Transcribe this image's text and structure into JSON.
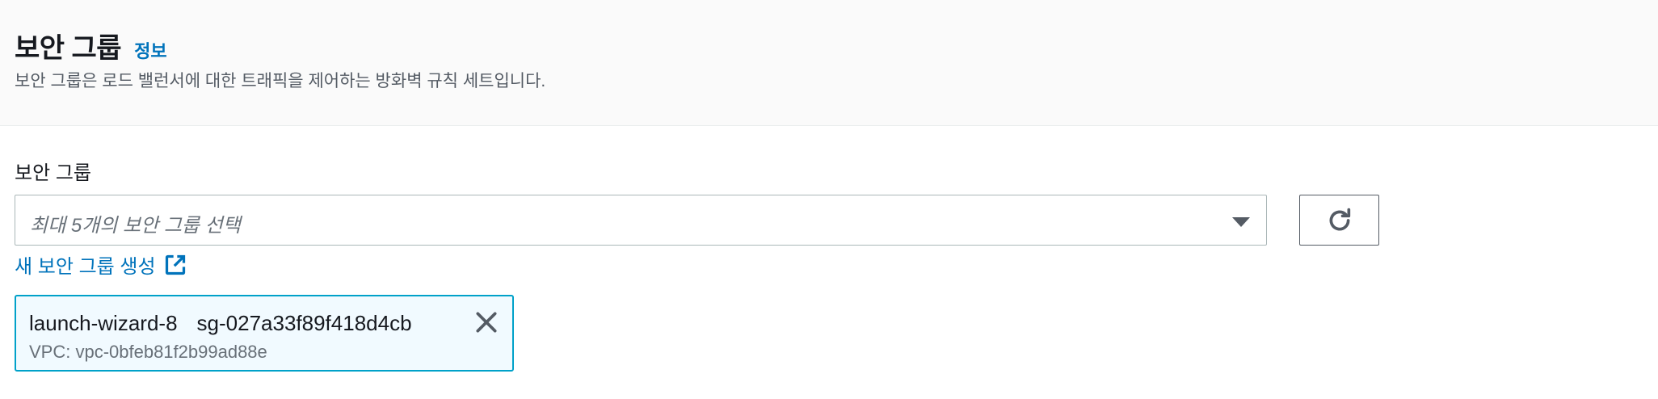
{
  "header": {
    "title": "보안 그룹",
    "info_link": "정보",
    "description": "보안 그룹은 로드 밸런서에 대한 트래픽을 제어하는 방화벽 규칙 세트입니다."
  },
  "field": {
    "label": "보안 그룹",
    "placeholder": "최대 5개의 보안 그룹 선택"
  },
  "create_link": "새 보안 그룹 생성",
  "selected_groups": [
    {
      "name": "launch-wizard-8",
      "id": "sg-027a33f89f418d4cb",
      "vpc": "VPC: vpc-0bfeb81f2b99ad88e"
    }
  ],
  "colors": {
    "link": "#0073bb",
    "token_border": "#00a1c9",
    "token_bg": "#f1faff"
  },
  "icons": [
    "refresh-icon",
    "external-link-icon",
    "close-icon",
    "caret-down-icon"
  ]
}
